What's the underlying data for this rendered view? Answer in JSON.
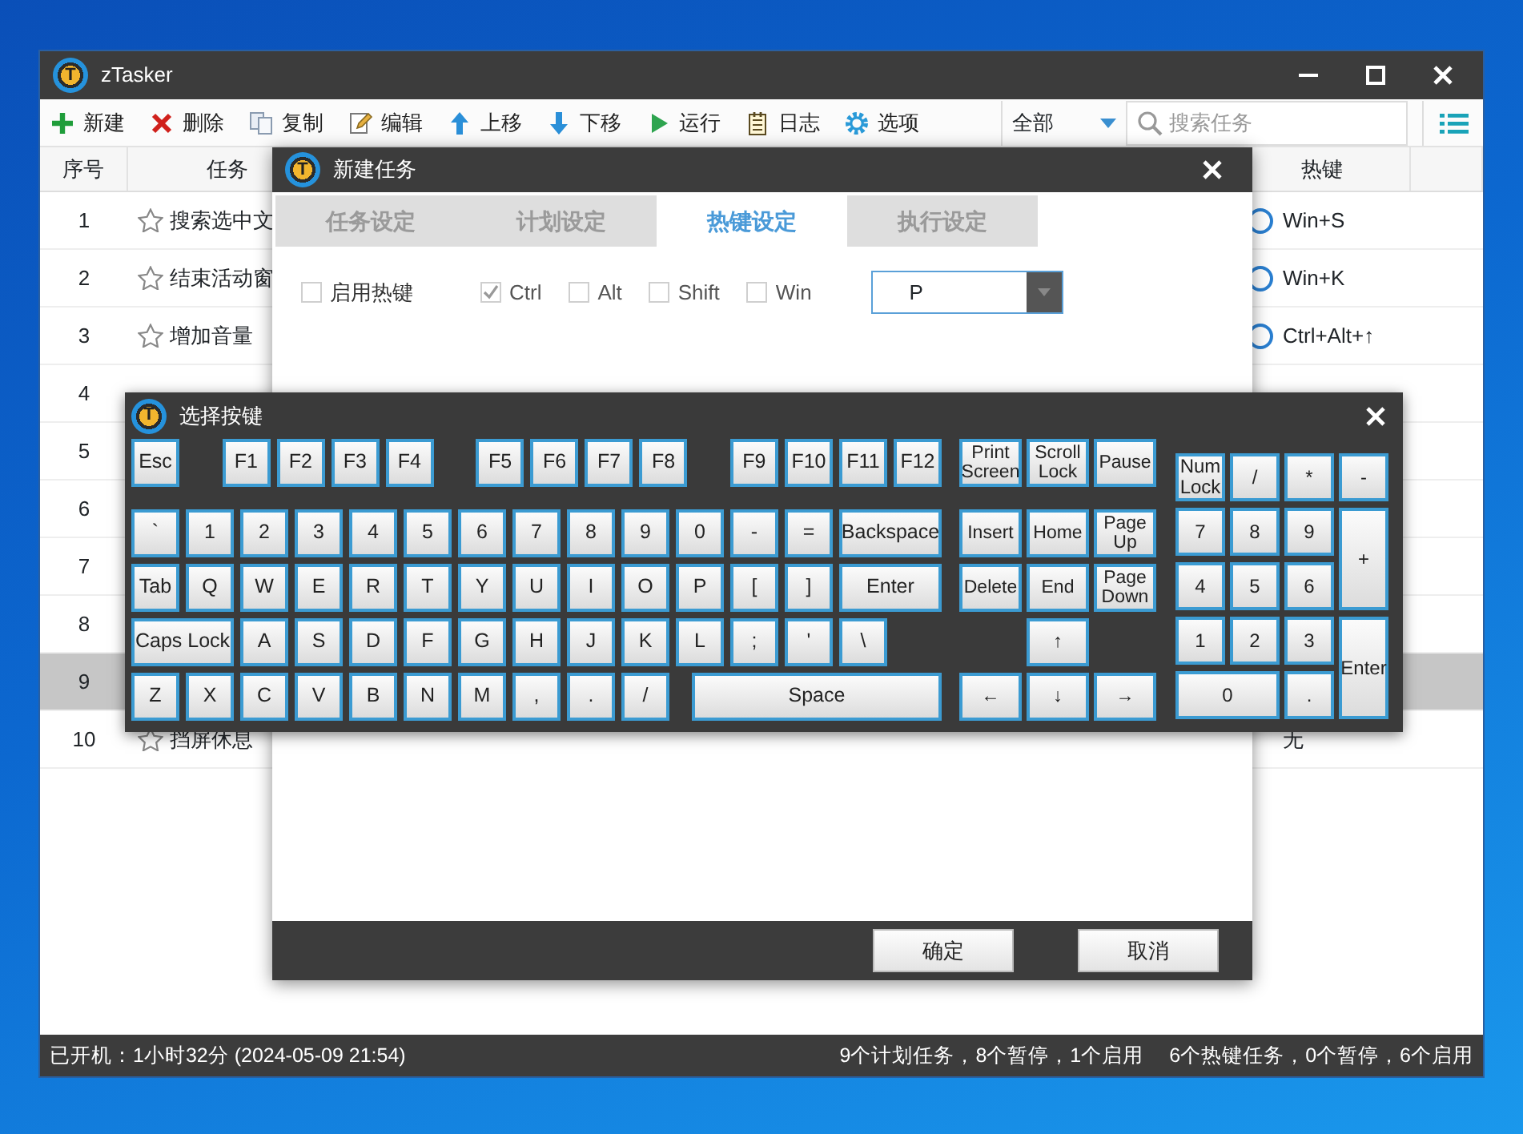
{
  "app": {
    "logo": "T",
    "title": "zTasker"
  },
  "toolbar": [
    {
      "label": "新建",
      "kind": "new"
    },
    {
      "label": "删除",
      "kind": "delete"
    },
    {
      "label": "复制",
      "kind": "copy"
    },
    {
      "label": "编辑",
      "kind": "edit"
    },
    {
      "label": "上移",
      "kind": "up"
    },
    {
      "label": "下移",
      "kind": "down"
    },
    {
      "label": "运行",
      "kind": "run"
    },
    {
      "label": "日志",
      "kind": "log"
    },
    {
      "label": "选项",
      "kind": "options"
    }
  ],
  "filter": {
    "value": "全部"
  },
  "search": {
    "placeholder": "搜索任务"
  },
  "table": {
    "columns": [
      "序号",
      "任务",
      "热键"
    ],
    "rows": [
      {
        "index": "1",
        "task": "搜索选中文",
        "hotkey": "Win+S",
        "hotkey_on": true,
        "selected": false
      },
      {
        "index": "2",
        "task": "结束活动窗",
        "hotkey": "Win+K",
        "hotkey_on": true,
        "selected": false
      },
      {
        "index": "3",
        "task": "增加音量",
        "hotkey": "Ctrl+Alt+↑",
        "hotkey_on": true,
        "selected": false
      },
      {
        "index": "4",
        "selected": false
      },
      {
        "index": "5",
        "selected": false
      },
      {
        "index": "6",
        "selected": false
      },
      {
        "index": "7",
        "selected": false
      },
      {
        "index": "8",
        "selected": false
      },
      {
        "index": "9",
        "selected": true
      },
      {
        "index": "10",
        "task": "挡屏休息",
        "hotkey": "无",
        "hotkey_on": false,
        "selected": false
      }
    ]
  },
  "status_bar": {
    "uptime": "已开机：1小时32分 (2024-05-09 21:54)",
    "plans": "9个计划任务，8个暂停，1个启用",
    "hotkeys": "6个热键任务，0个暂停，6个启用"
  },
  "dialog": {
    "logo": "T",
    "title": "新建任务",
    "tabs": [
      {
        "label": "任务设定",
        "selected": false
      },
      {
        "label": "计划设定",
        "selected": false
      },
      {
        "label": "热键设定",
        "selected": true
      },
      {
        "label": "执行设定",
        "selected": false
      }
    ],
    "enable_hotkey": {
      "label": "启用热键",
      "checked": false
    },
    "modifiers": [
      {
        "label": "Ctrl",
        "checked": true
      },
      {
        "label": "Alt",
        "checked": false
      },
      {
        "label": "Shift",
        "checked": false
      },
      {
        "label": "Win",
        "checked": false
      }
    ],
    "key_field": {
      "value": "P"
    },
    "buttons": [
      "确定",
      "取消"
    ]
  },
  "keyboard": {
    "logo": "T",
    "title": "选择按键",
    "function_row": [
      [
        {
          "label": "Esc",
          "kind": "key"
        }
      ],
      [
        {
          "label": "F1",
          "kind": "key"
        },
        {
          "label": "F2",
          "kind": "key"
        },
        {
          "label": "F3",
          "kind": "key"
        },
        {
          "label": "F4",
          "kind": "key"
        }
      ],
      [
        {
          "label": "F5",
          "kind": "key"
        },
        {
          "label": "F6",
          "kind": "key"
        },
        {
          "label": "F7",
          "kind": "key"
        },
        {
          "label": "F8",
          "kind": "key"
        }
      ],
      [
        {
          "label": "F9",
          "kind": "key"
        },
        {
          "label": "F10",
          "kind": "key"
        },
        {
          "label": "F11",
          "kind": "key"
        },
        {
          "label": "F12",
          "kind": "key"
        }
      ]
    ],
    "main_rows": [
      [
        {
          "label": "`",
          "kind": "key"
        },
        {
          "label": "1",
          "kind": "key"
        },
        {
          "label": "2",
          "kind": "key"
        },
        {
          "label": "3",
          "kind": "key"
        },
        {
          "label": "4",
          "kind": "key"
        },
        {
          "label": "5",
          "kind": "key"
        },
        {
          "label": "6",
          "kind": "key"
        },
        {
          "label": "7",
          "kind": "key"
        },
        {
          "label": "8",
          "kind": "key"
        },
        {
          "label": "9",
          "kind": "key"
        },
        {
          "label": "0",
          "kind": "key"
        },
        {
          "label": "-",
          "kind": "key"
        },
        {
          "label": "=",
          "kind": "key"
        },
        {
          "label": "Backspace",
          "kind": "wide"
        }
      ],
      [
        {
          "label": "Tab",
          "kind": "key"
        },
        {
          "label": "Q",
          "kind": "key"
        },
        {
          "label": "W",
          "kind": "key"
        },
        {
          "label": "E",
          "kind": "key"
        },
        {
          "label": "R",
          "kind": "key"
        },
        {
          "label": "T",
          "kind": "key"
        },
        {
          "label": "Y",
          "kind": "key"
        },
        {
          "label": "U",
          "kind": "key"
        },
        {
          "label": "I",
          "kind": "key"
        },
        {
          "label": "O",
          "kind": "key"
        },
        {
          "label": "P",
          "kind": "key"
        },
        {
          "label": "[",
          "kind": "key"
        },
        {
          "label": "]",
          "kind": "key"
        },
        {
          "label": "Enter",
          "kind": "wide"
        }
      ],
      [
        {
          "label": "Caps Lock",
          "kind": "wide"
        },
        {
          "label": "A",
          "kind": "key"
        },
        {
          "label": "S",
          "kind": "key"
        },
        {
          "label": "D",
          "kind": "key"
        },
        {
          "label": "F",
          "kind": "key"
        },
        {
          "label": "G",
          "kind": "key"
        },
        {
          "label": "H",
          "kind": "key"
        },
        {
          "label": "J",
          "kind": "key"
        },
        {
          "label": "K",
          "kind": "key"
        },
        {
          "label": "L",
          "kind": "key"
        },
        {
          "label": ";",
          "kind": "key"
        },
        {
          "label": "'",
          "kind": "key"
        },
        {
          "label": "\\",
          "kind": "key"
        }
      ],
      [
        {
          "label": "Z",
          "kind": "key"
        },
        {
          "label": "X",
          "kind": "key"
        },
        {
          "label": "C",
          "kind": "key"
        },
        {
          "label": "V",
          "kind": "key"
        },
        {
          "label": "B",
          "kind": "key"
        },
        {
          "label": "N",
          "kind": "key"
        },
        {
          "label": "M",
          "kind": "key"
        },
        {
          "label": ",",
          "kind": "key"
        },
        {
          "label": ".",
          "kind": "key"
        },
        {
          "label": "/",
          "kind": "key"
        },
        {
          "label": "Space",
          "kind": "space"
        }
      ]
    ],
    "nav_rows": [
      [
        {
          "label": "Print Screen",
          "kind": "key"
        },
        {
          "label": "Scroll Lock",
          "kind": "key"
        },
        {
          "label": "Pause",
          "kind": "key"
        }
      ],
      [
        {
          "label": "Insert",
          "kind": "key"
        },
        {
          "label": "Home",
          "kind": "key"
        },
        {
          "label": "Page Up",
          "kind": "key"
        }
      ],
      [
        {
          "label": "Delete",
          "kind": "key"
        },
        {
          "label": "End",
          "kind": "key"
        },
        {
          "label": "Page Down",
          "kind": "key"
        }
      ],
      [
        {
          "label": "↑",
          "kind": "middle"
        }
      ],
      [
        {
          "label": "←",
          "kind": "key"
        },
        {
          "label": "↓",
          "kind": "key"
        },
        {
          "label": "→",
          "kind": "key"
        }
      ]
    ],
    "numpad": [
      {
        "label": "Num Lock",
        "kind": "key"
      },
      {
        "label": "/",
        "kind": "key"
      },
      {
        "label": "*",
        "kind": "key"
      },
      {
        "label": "-",
        "kind": "key"
      },
      {
        "label": "7",
        "kind": "key"
      },
      {
        "label": "8",
        "kind": "key"
      },
      {
        "label": "9",
        "kind": "key"
      },
      {
        "label": "+",
        "kind": "tall"
      },
      {
        "label": "4",
        "kind": "key"
      },
      {
        "label": "5",
        "kind": "key"
      },
      {
        "label": "6",
        "kind": "key"
      },
      {
        "label": "1",
        "kind": "key"
      },
      {
        "label": "2",
        "kind": "key"
      },
      {
        "label": "3",
        "kind": "key"
      },
      {
        "label": "Enter",
        "kind": "tall"
      },
      {
        "label": "0",
        "kind": "double"
      },
      {
        "label": ".",
        "kind": "key"
      }
    ]
  }
}
